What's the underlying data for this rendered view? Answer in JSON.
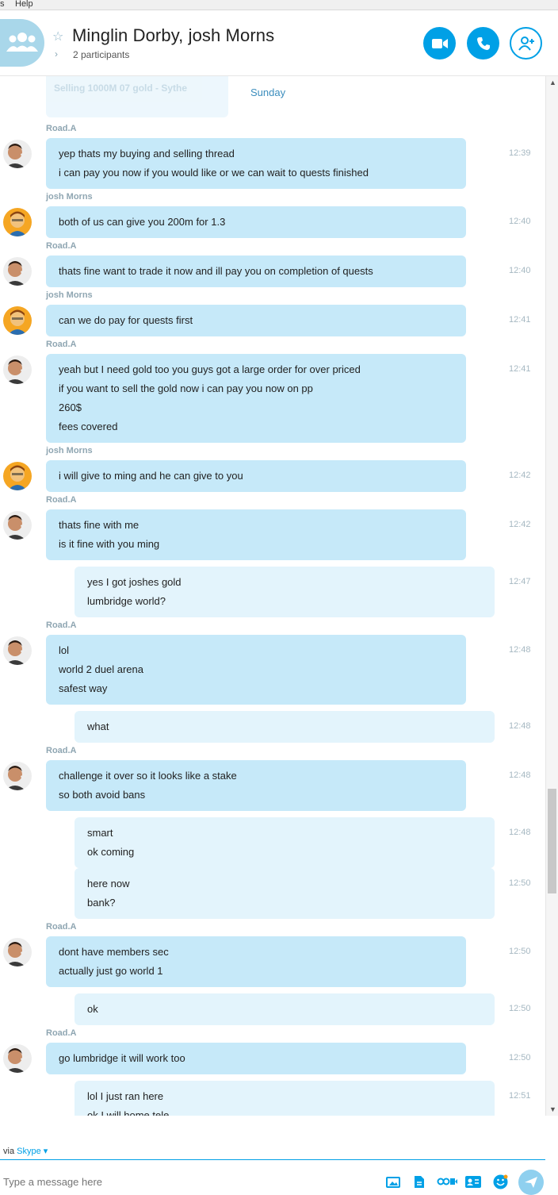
{
  "menu": {
    "item1": "s",
    "item2": "Help"
  },
  "header": {
    "title": "Minglin Dorby, josh Morns",
    "participants": "2 participants"
  },
  "chat": {
    "faded_preview": "Selling 1000M 07 gold - Sythe",
    "day_label": "Sunday",
    "messages": [
      {
        "sender": "Road.A",
        "lines": [
          "yep thats my buying and selling thread",
          "i can pay you now if you would like or we can wait to quests finished"
        ],
        "time": "12:39"
      },
      {
        "sender": "josh Morns",
        "lines": [
          "both of us can give you 200m for 1.3"
        ],
        "time": "12:40"
      },
      {
        "sender": "Road.A",
        "lines": [
          "thats fine want to trade it now and ill pay you on completion of quests"
        ],
        "time": "12:40"
      },
      {
        "sender": "josh Morns",
        "lines": [
          "can we do pay for quests first"
        ],
        "time": "12:41"
      },
      {
        "sender": "Road.A",
        "lines": [
          "yeah but I need gold too you guys got a large order for over priced",
          "if you want to sell the gold now i can pay you now on pp",
          "260$",
          "fees covered"
        ],
        "time": "12:41"
      },
      {
        "sender": "josh Morns",
        "lines": [
          "i will give to ming and he can give to you"
        ],
        "time": "12:42"
      },
      {
        "sender": "Road.A",
        "lines": [
          "thats fine with me",
          "is it fine with you ming"
        ],
        "time": "12:42"
      },
      {
        "sender": "",
        "lines": [
          "yes I got joshes gold",
          "lumbridge world?"
        ],
        "time": "12:47"
      },
      {
        "sender": "Road.A",
        "lines": [
          "lol",
          "world 2 duel arena",
          "safest way"
        ],
        "time": "12:48"
      },
      {
        "sender": "",
        "lines": [
          "what"
        ],
        "time": "12:48"
      },
      {
        "sender": "Road.A",
        "lines": [
          "challenge it over so it looks like a stake",
          "so both avoid bans"
        ],
        "time": "12:48"
      },
      {
        "sender": "",
        "lines": [
          "smart",
          "ok coming"
        ],
        "time": "12:48"
      },
      {
        "sender": "",
        "lines": [
          "here now",
          "bank?"
        ],
        "time": "12:50"
      },
      {
        "sender": "Road.A",
        "lines": [
          "dont have members sec",
          "actually just go world 1"
        ],
        "time": "12:50"
      },
      {
        "sender": "",
        "lines": [
          "ok"
        ],
        "time": "12:50"
      },
      {
        "sender": "Road.A",
        "lines": [
          "go lumbridge it will work too"
        ],
        "time": "12:50"
      },
      {
        "sender": "",
        "lines": [
          "lol I just ran here",
          "ok I will home tele"
        ],
        "time": "12:51"
      }
    ]
  },
  "footer": {
    "via_prefix": "via",
    "via_link": "Skype ▾",
    "input_placeholder": "Type a message here"
  },
  "colors": {
    "accent": "#00a0e6",
    "incoming_bubble": "#c6e9f9",
    "outgoing_bubble": "#e3f4fc"
  }
}
